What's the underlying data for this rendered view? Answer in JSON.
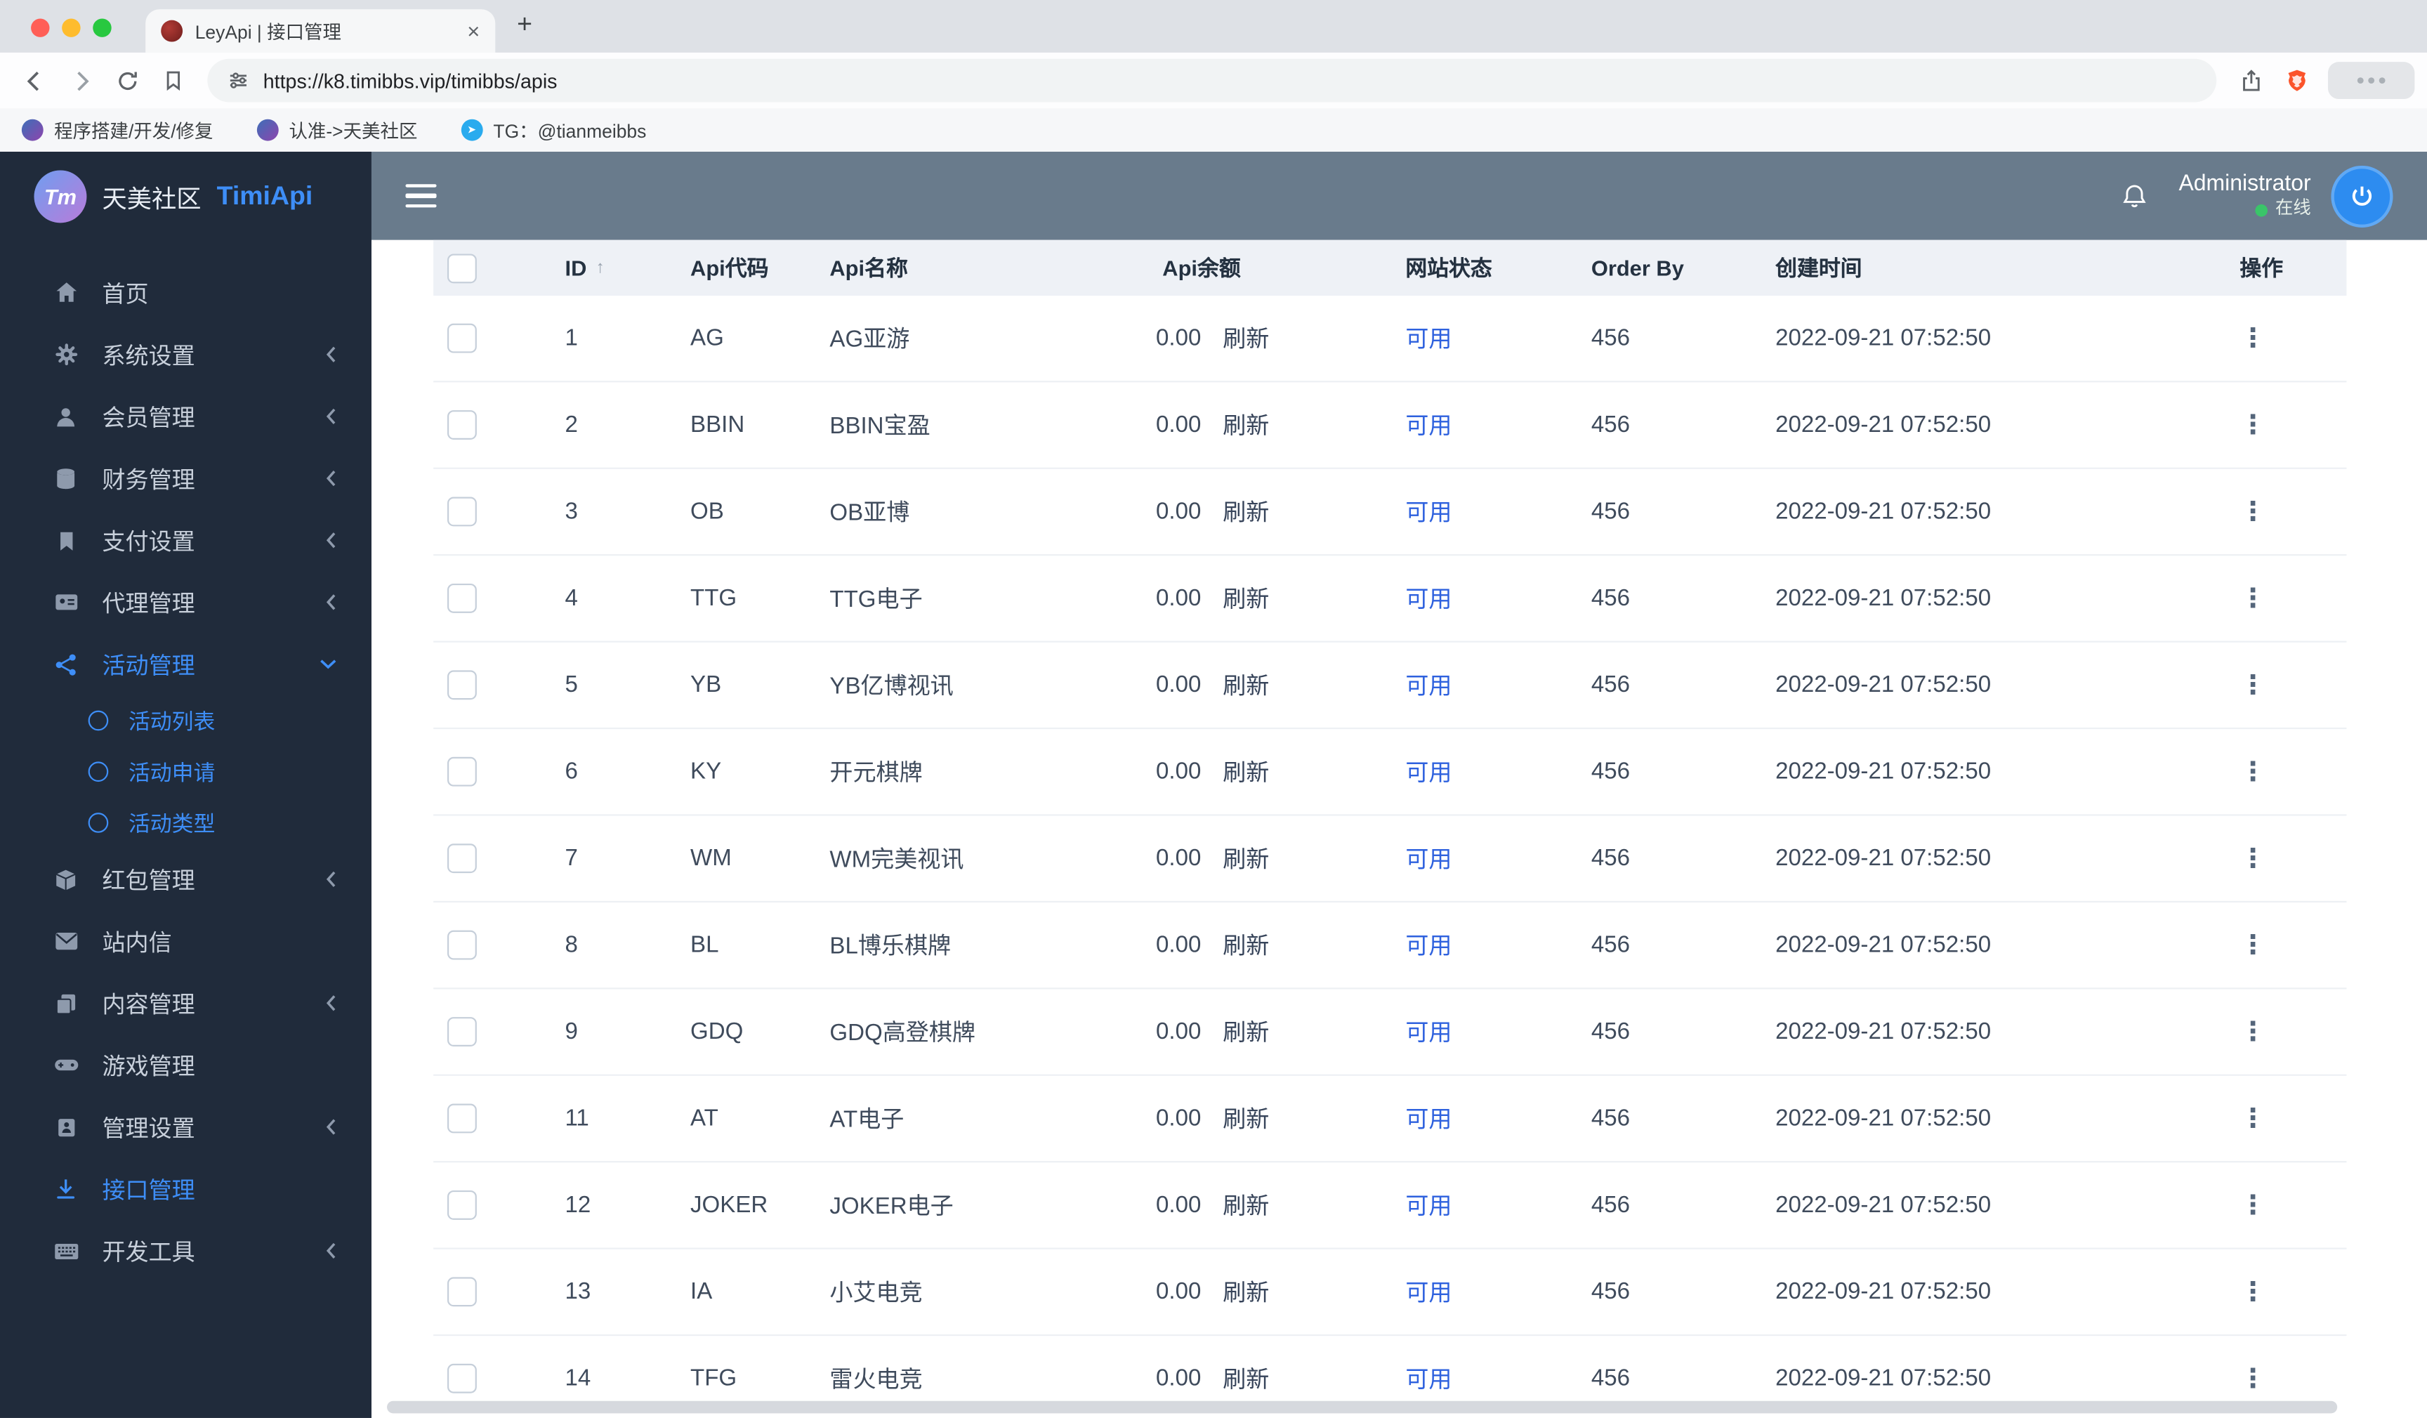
{
  "browser": {
    "tab_title": "LeyApi | 接口管理",
    "url": "https://k8.timibbs.vip/timibbs/apis",
    "bookmarks": [
      "程序搭建/开发/修复",
      "认准->天美社区",
      "TG：@tianmeibbs"
    ],
    "close_glyph": "×",
    "new_tab_glyph": "+"
  },
  "sidebar": {
    "logo_monogram": "Tm",
    "brand_cn": "天美社区",
    "brand_en": "TimiApi",
    "items": [
      {
        "label": "首页",
        "icon": "home-icon"
      },
      {
        "label": "系统设置",
        "icon": "gears-icon",
        "has_children": true
      },
      {
        "label": "会员管理",
        "icon": "user-icon",
        "has_children": true
      },
      {
        "label": "财务管理",
        "icon": "database-icon",
        "has_children": true
      },
      {
        "label": "支付设置",
        "icon": "bookmark-icon",
        "has_children": true
      },
      {
        "label": "代理管理",
        "icon": "id-card-icon",
        "has_children": true
      },
      {
        "label": "活动管理",
        "icon": "share-nodes-icon",
        "has_children": true,
        "expanded": true,
        "active": true,
        "children": [
          {
            "label": "活动列表"
          },
          {
            "label": "活动申请"
          },
          {
            "label": "活动类型"
          }
        ]
      },
      {
        "label": "红包管理",
        "icon": "cube-icon",
        "has_children": true
      },
      {
        "label": "站内信",
        "icon": "envelope-icon"
      },
      {
        "label": "内容管理",
        "icon": "copy-icon",
        "has_children": true
      },
      {
        "label": "游戏管理",
        "icon": "gamepad-icon"
      },
      {
        "label": "管理设置",
        "icon": "address-book-icon",
        "has_children": true
      },
      {
        "label": "接口管理",
        "icon": "download-icon",
        "active": true
      },
      {
        "label": "开发工具",
        "icon": "keyboard-icon",
        "has_children": true
      }
    ]
  },
  "topbar": {
    "username": "Administrator",
    "status": "在线"
  },
  "table": {
    "columns": [
      "ID",
      "Api代码",
      "Api名称",
      "Api余额",
      "网站状态",
      "Order By",
      "创建时间",
      "操作"
    ],
    "sort_icon": "↑",
    "refresh_label": "刷新",
    "status_available": "可用",
    "actions_icon": "⋮",
    "rows": [
      {
        "id": "1",
        "code": "AG",
        "name": "AG亚游",
        "balance": "0.00",
        "order_by": "456",
        "created": "2022-09-21 07:52:50"
      },
      {
        "id": "2",
        "code": "BBIN",
        "name": "BBIN宝盈",
        "balance": "0.00",
        "order_by": "456",
        "created": "2022-09-21 07:52:50"
      },
      {
        "id": "3",
        "code": "OB",
        "name": "OB亚博",
        "balance": "0.00",
        "order_by": "456",
        "created": "2022-09-21 07:52:50"
      },
      {
        "id": "4",
        "code": "TTG",
        "name": "TTG电子",
        "balance": "0.00",
        "order_by": "456",
        "created": "2022-09-21 07:52:50"
      },
      {
        "id": "5",
        "code": "YB",
        "name": "YB亿博视讯",
        "balance": "0.00",
        "order_by": "456",
        "created": "2022-09-21 07:52:50"
      },
      {
        "id": "6",
        "code": "KY",
        "name": "开元棋牌",
        "balance": "0.00",
        "order_by": "456",
        "created": "2022-09-21 07:52:50"
      },
      {
        "id": "7",
        "code": "WM",
        "name": "WM完美视讯",
        "balance": "0.00",
        "order_by": "456",
        "created": "2022-09-21 07:52:50"
      },
      {
        "id": "8",
        "code": "BL",
        "name": "BL博乐棋牌",
        "balance": "0.00",
        "order_by": "456",
        "created": "2022-09-21 07:52:50"
      },
      {
        "id": "9",
        "code": "GDQ",
        "name": "GDQ高登棋牌",
        "balance": "0.00",
        "order_by": "456",
        "created": "2022-09-21 07:52:50"
      },
      {
        "id": "11",
        "code": "AT",
        "name": "AT电子",
        "balance": "0.00",
        "order_by": "456",
        "created": "2022-09-21 07:52:50"
      },
      {
        "id": "12",
        "code": "JOKER",
        "name": "JOKER电子",
        "balance": "0.00",
        "order_by": "456",
        "created": "2022-09-21 07:52:50"
      },
      {
        "id": "13",
        "code": "IA",
        "name": "小艾电竞",
        "balance": "0.00",
        "order_by": "456",
        "created": "2022-09-21 07:52:50"
      },
      {
        "id": "14",
        "code": "TFG",
        "name": "雷火电竞",
        "balance": "0.00",
        "order_by": "456",
        "created": "2022-09-21 07:52:50"
      }
    ]
  },
  "colors": {
    "accent_blue": "#3e8ef7",
    "status_blue": "#2e61de",
    "sidebar_bg": "#202b3b",
    "topbar_bg": "#697b8c",
    "online_green": "#3ac569",
    "table_header_bg": "#eef1f6",
    "brave_orange": "#fb542b"
  }
}
